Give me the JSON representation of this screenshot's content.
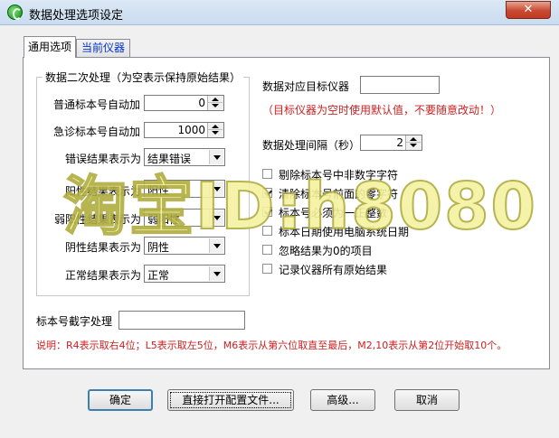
{
  "window": {
    "title": "数据处理选项设定",
    "close_label": "✕"
  },
  "tabs": [
    "通用选项",
    "当前仪器"
  ],
  "group": {
    "legend": "数据二次处理（为空表示保持原始结果）",
    "routine_label": "普通标本号自动加",
    "routine_value": "0",
    "emergency_label": "急诊标本号自动加",
    "emergency_value": "1000",
    "error_label": "错误结果表示为",
    "error_value": "结果错误",
    "positive_label": "阳性结果表示为",
    "positive_value": "阳性",
    "weak_label": "弱阳性结果表示为",
    "weak_value": "弱阳性",
    "negative_label": "阴性结果表示为",
    "negative_value": "阴性",
    "normal_label": "正常结果表示为",
    "normal_value": "正常"
  },
  "target": {
    "label": "数据对应目标仪器",
    "value": "",
    "note": "（目标仪器为空时使用默认值，不要随意改动！）"
  },
  "interval": {
    "label": "数据处理间隔（秒）",
    "value": "2"
  },
  "checks": [
    {
      "label": "剔除标本号中非数字字符",
      "checked": false
    },
    {
      "label": "清除标本号前面的零字符",
      "checked": true
    },
    {
      "label": "标本号必须为一正整数",
      "checked": true
    },
    {
      "label": "标本日期使用电脑系统日期",
      "checked": false
    },
    {
      "label": "忽略结果为0的项目",
      "checked": false
    },
    {
      "label": "记录仪器所有原始结果",
      "checked": false
    }
  ],
  "truncate": {
    "label": "标本号截字处理",
    "value": ""
  },
  "explain": "说明：R4表示取右4位；L5表示取左5位，M6表示从第六位取直至最后，M2,10表示从第2位开始取10个。",
  "buttons": {
    "ok": "确定",
    "open_config": "直接打开配置文件...",
    "advanced": "高级...",
    "cancel": "取消"
  },
  "watermark": "淘宝ID:h8080"
}
